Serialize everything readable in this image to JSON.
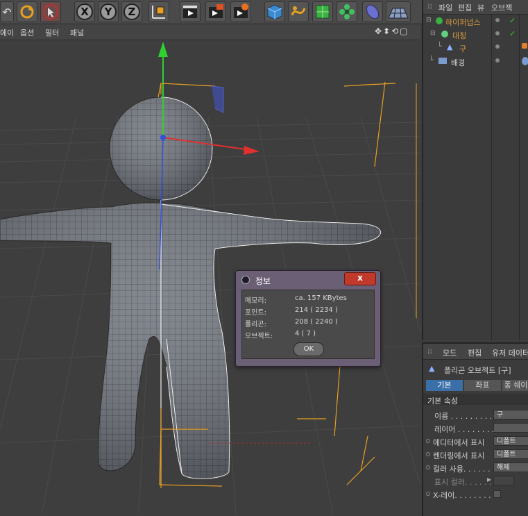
{
  "toolbar": {
    "icons": [
      "undo-icon",
      "redo-icon",
      "live-select-icon",
      "x-axis-lock-icon",
      "y-axis-lock-icon",
      "z-axis-lock-icon",
      "coordinate-system-icon",
      "render-view-icon",
      "render-picture-viewer-icon",
      "render-settings-icon",
      "cube-icon",
      "spline-pen-icon",
      "subdivision-surface-icon",
      "array-icon",
      "deformer-icon",
      "floor-icon"
    ],
    "x_label": "X",
    "y_label": "Y",
    "z_label": "Z"
  },
  "viewport_menu": [
    "에이",
    "옵션",
    "필터",
    "패널"
  ],
  "object_manager": {
    "menu": [
      "파일",
      "편집",
      "뷰",
      "오브젝"
    ],
    "tree": [
      {
        "label": "하이퍼넙스",
        "color": "#e0a040"
      },
      {
        "label": "대칭",
        "color": "#e0a040"
      },
      {
        "label": "구",
        "color": "#e0a040"
      },
      {
        "label": "배경",
        "color": "#d0d0d0"
      }
    ]
  },
  "attribute_manager": {
    "menu": [
      "모드",
      "편집",
      "유저 데이터"
    ],
    "object_title": "폴리곤 오브젝트 [구]",
    "tabs": [
      "기본",
      "좌표",
      "퐁 쉐이"
    ],
    "section": "기본 속성",
    "props": [
      {
        "label": "이름 . . . . . . . . . . .",
        "value": "구"
      },
      {
        "label": "레이어 . . . . . . . . .",
        "value": ""
      },
      {
        "label": "에디터에서 표시",
        "value": "디폴트"
      },
      {
        "label": "렌더링에서 표시",
        "value": "디폴트"
      },
      {
        "label": "컬러 사용. . . . . . .",
        "value": "해제"
      },
      {
        "label": "표시 컬러. . . . . .",
        "value": ""
      },
      {
        "label": "X-레이. . . . . . . . .",
        "value": ""
      }
    ]
  },
  "dialog": {
    "title": "정보",
    "close_label": "x",
    "rows": [
      {
        "label": "메모리:",
        "value": "ca. 157 KBytes"
      },
      {
        "label": "포인트:",
        "value": "214 ( 2234 )"
      },
      {
        "label": "폴리곤:",
        "value": "208 ( 2240 )"
      },
      {
        "label": "오브젝트:",
        "value": "4 ( 7 )"
      }
    ],
    "ok_label": "OK"
  },
  "colors": {
    "accent_orange": "#e0a040",
    "active_tab": "#3a6fa8",
    "axis_x": "#e03030",
    "axis_y": "#30d030",
    "axis_z": "#3050e0"
  }
}
